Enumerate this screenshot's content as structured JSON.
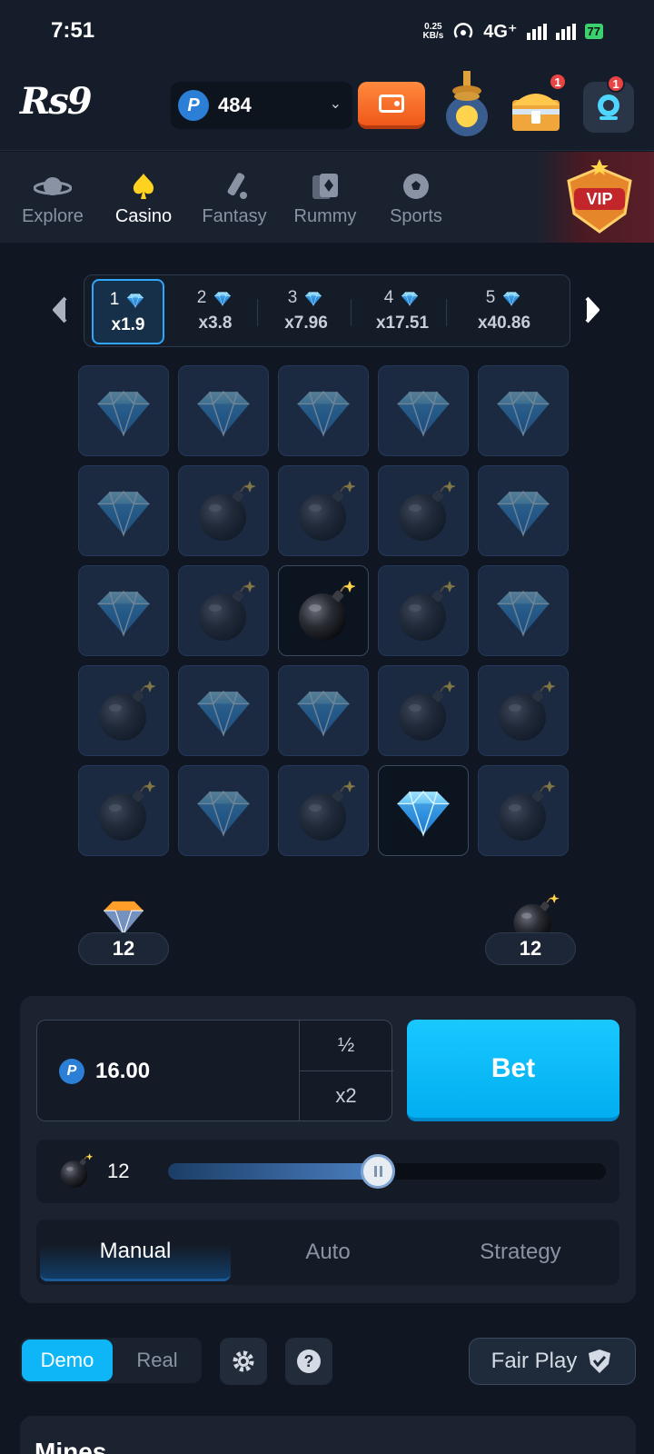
{
  "status_bar": {
    "time": "7:51",
    "net_speed_value": "0.25",
    "net_speed_unit": "KB/s",
    "network": "4G⁺",
    "battery": "77"
  },
  "header": {
    "logo": "Rs9",
    "balance_coin": "P",
    "balance": "484",
    "chest_badge": "1",
    "support_badge": "1"
  },
  "nav": {
    "items": [
      {
        "label": "Explore"
      },
      {
        "label": "Casino"
      },
      {
        "label": "Fantasy"
      },
      {
        "label": "Rummy"
      },
      {
        "label": "Sports"
      }
    ],
    "active": "Casino",
    "vip_label": "VIP"
  },
  "multipliers": [
    {
      "gems": "1",
      "value": "x1.9",
      "active": true
    },
    {
      "gems": "2",
      "value": "x3.8",
      "active": false
    },
    {
      "gems": "3",
      "value": "x7.96",
      "active": false
    },
    {
      "gems": "4",
      "value": "x17.51",
      "active": false
    },
    {
      "gems": "5",
      "value": "x40.86",
      "active": false
    }
  ],
  "board": {
    "rows": [
      [
        "gem",
        "gem",
        "gem",
        "gem",
        "gem"
      ],
      [
        "gem",
        "bomb",
        "bomb",
        "bomb",
        "gem"
      ],
      [
        "gem",
        "bomb",
        "bomb-revealed",
        "bomb",
        "gem"
      ],
      [
        "bomb",
        "gem",
        "gem",
        "bomb",
        "bomb"
      ],
      [
        "bomb",
        "gem",
        "bomb",
        "gem-revealed",
        "bomb"
      ]
    ],
    "gems_count": "12",
    "mines_count": "12"
  },
  "bet_panel": {
    "coin": "P",
    "amount": "16.00",
    "half_label": "½",
    "double_label": "x2",
    "bet_label": "Bet",
    "mines_value": "12",
    "mines_slider_fraction": 0.48,
    "tabs": [
      "Manual",
      "Auto",
      "Strategy"
    ],
    "active_tab": "Manual"
  },
  "footer": {
    "demo_label": "Demo",
    "real_label": "Real",
    "fair_play_label": "Fair Play",
    "game_title": "Mines"
  },
  "colors": {
    "accent": "#0fb6f7",
    "wallet": "#f0581a",
    "badge": "#e94343",
    "background": "#101722"
  }
}
